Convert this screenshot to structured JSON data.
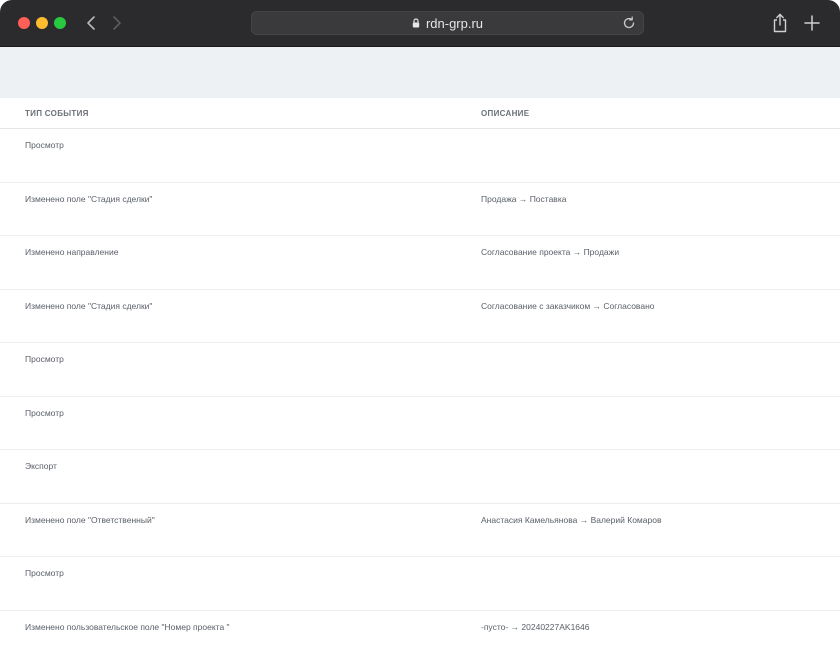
{
  "browser": {
    "url": "rdn-grp.ru"
  },
  "table": {
    "headers": {
      "event_type": "Тип события",
      "description": "Описание"
    },
    "rows": [
      {
        "event": "Просмотр",
        "description": ""
      },
      {
        "event": "Изменено поле \"Стадия сделки\"",
        "description": "Продажа → Поставка"
      },
      {
        "event": "Изменено направление",
        "description": "Согласование проекта → Продажи"
      },
      {
        "event": "Изменено поле \"Стадия сделки\"",
        "description": "Согласование с заказчиком → Согласовано"
      },
      {
        "event": "Просмотр",
        "description": ""
      },
      {
        "event": "Просмотр",
        "description": ""
      },
      {
        "event": "Экспорт",
        "description": ""
      },
      {
        "event": "Изменено поле \"Ответственный\"",
        "description": "Анастасия Камельянова → Валерий Комаров"
      },
      {
        "event": "Просмотр",
        "description": ""
      },
      {
        "event": "Изменено пользовательское поле \"Номер проекта \"",
        "description": "-пусто- → 20240227AK1646"
      }
    ]
  }
}
